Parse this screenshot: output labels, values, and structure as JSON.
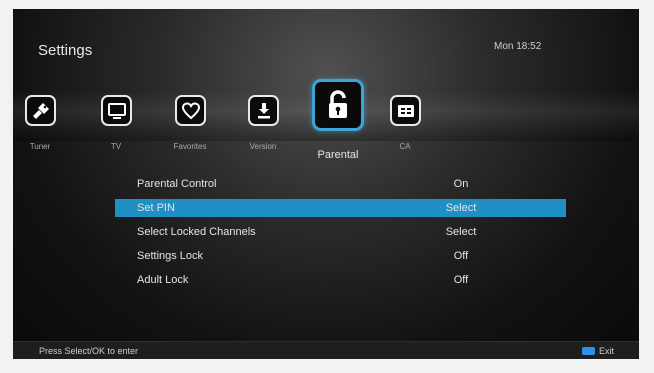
{
  "header": {
    "title": "Settings",
    "clock": "Mon 18:52"
  },
  "categories": [
    {
      "label": "Tuner",
      "icon": "tuner-icon"
    },
    {
      "label": "TV",
      "icon": "tv-icon"
    },
    {
      "label": "Favorites",
      "icon": "heart-icon"
    },
    {
      "label": "Version",
      "icon": "download-icon"
    },
    {
      "label": "Parental",
      "icon": "lock-icon",
      "selected": true
    },
    {
      "label": "CA",
      "icon": "card-icon"
    }
  ],
  "menu": [
    {
      "label": "Parental Control",
      "value": "On"
    },
    {
      "label": "Set PIN",
      "value": "Select",
      "selected": true
    },
    {
      "label": "Select Locked Channels",
      "value": "Select"
    },
    {
      "label": "Settings Lock",
      "value": "Off"
    },
    {
      "label": "Adult Lock",
      "value": "Off"
    }
  ],
  "footer": {
    "hint": "Press Select/OK to enter",
    "exit_label": "Exit",
    "exit_key_color": "#2f8fe0"
  },
  "colors": {
    "accent": "#1f8fc4",
    "selected_icon_border": "#3ea3d6"
  }
}
